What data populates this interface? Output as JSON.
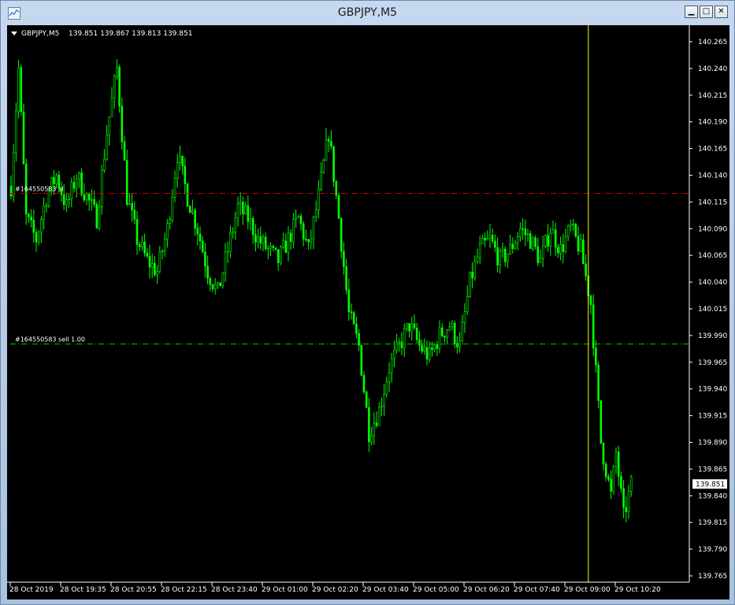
{
  "window": {
    "title": "GBPJPY,M5",
    "icon": "chart-window-icon"
  },
  "controls": {
    "minimize_icon": "minimize-icon",
    "maximize_icon": "maximize-icon",
    "close_icon": "close-icon"
  },
  "colors": {
    "background": "#000000",
    "candle": "#00ff00",
    "axis_text": "#ffffff",
    "sell_line": "#00cc00",
    "stop_line": "#cc0000",
    "crosshair": "#ffff00",
    "price_tag_bg": "#ffffff"
  },
  "chart_data": {
    "type": "candlestick",
    "symbol_label": "GBPJPY,M5",
    "ohlc_label": "139.851 139.867 139.813 139.851",
    "ylim": [
      139.755,
      140.275
    ],
    "y_ticks": [
      "140.265",
      "140.240",
      "140.215",
      "140.190",
      "140.165",
      "140.140",
      "140.115",
      "140.090",
      "140.065",
      "140.040",
      "140.015",
      "139.990",
      "139.965",
      "139.940",
      "139.915",
      "139.890",
      "139.865",
      "139.840",
      "139.815",
      "139.790",
      "139.765"
    ],
    "x_ticks": [
      "28 Oct 2019",
      "28 Oct 19:35",
      "28 Oct 20:55",
      "28 Oct 22:15",
      "28 Oct 23:40",
      "29 Oct 01:00",
      "29 Oct 02:20",
      "29 Oct 03:40",
      "29 Oct 05:00",
      "29 Oct 06:20",
      "29 Oct 07:40",
      "29 Oct 09:00",
      "29 Oct 10:20"
    ],
    "current_price": "139.851",
    "order_lines": [
      {
        "label": "#164550583 sell 1.00",
        "price": 139.982,
        "style": "sell"
      },
      {
        "label": "#164550583 sl",
        "price": 140.123,
        "style": "stop"
      }
    ],
    "vertical_marker_index": 229,
    "close_path": [
      [
        0,
        140.13
      ],
      [
        3,
        140.24
      ],
      [
        6,
        140.1
      ],
      [
        10,
        140.08
      ],
      [
        14,
        140.12
      ],
      [
        18,
        140.14
      ],
      [
        22,
        140.11
      ],
      [
        26,
        140.14
      ],
      [
        30,
        140.12
      ],
      [
        34,
        140.1
      ],
      [
        38,
        140.18
      ],
      [
        42,
        140.24
      ],
      [
        46,
        140.12
      ],
      [
        50,
        140.08
      ],
      [
        54,
        140.06
      ],
      [
        58,
        140.05
      ],
      [
        62,
        140.09
      ],
      [
        66,
        140.16
      ],
      [
        70,
        140.12
      ],
      [
        74,
        140.09
      ],
      [
        78,
        140.05
      ],
      [
        82,
        140.03
      ],
      [
        86,
        140.07
      ],
      [
        90,
        140.11
      ],
      [
        94,
        140.1
      ],
      [
        98,
        140.08
      ],
      [
        102,
        140.07
      ],
      [
        106,
        140.06
      ],
      [
        110,
        140.08
      ],
      [
        114,
        140.1
      ],
      [
        118,
        140.07
      ],
      [
        122,
        140.12
      ],
      [
        126,
        140.18
      ],
      [
        130,
        140.1
      ],
      [
        134,
        140.01
      ],
      [
        138,
        139.98
      ],
      [
        142,
        139.9
      ],
      [
        146,
        139.92
      ],
      [
        150,
        139.96
      ],
      [
        154,
        139.98
      ],
      [
        158,
        140.0
      ],
      [
        162,
        139.98
      ],
      [
        166,
        139.97
      ],
      [
        170,
        139.99
      ],
      [
        174,
        140.0
      ],
      [
        178,
        139.98
      ],
      [
        182,
        140.04
      ],
      [
        186,
        140.07
      ],
      [
        190,
        140.08
      ],
      [
        194,
        140.06
      ],
      [
        198,
        140.07
      ],
      [
        202,
        140.09
      ],
      [
        206,
        140.08
      ],
      [
        210,
        140.06
      ],
      [
        214,
        140.09
      ],
      [
        218,
        140.07
      ],
      [
        222,
        140.09
      ],
      [
        226,
        140.07
      ],
      [
        230,
        140.02
      ],
      [
        234,
        139.89
      ],
      [
        238,
        139.84
      ],
      [
        240,
        139.88
      ],
      [
        243,
        139.82
      ],
      [
        246,
        139.85
      ]
    ],
    "series_amplitude": 0.012
  }
}
